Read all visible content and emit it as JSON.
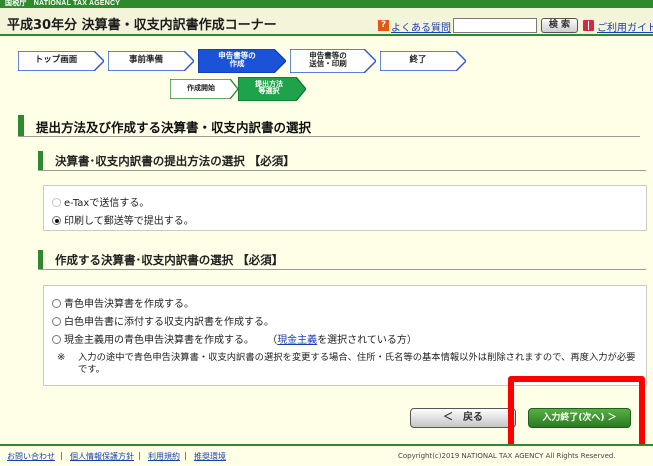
{
  "header": {
    "agency": "国税庁　NATIONAL TAX AGENCY",
    "app_title": "平成30年分 決算書・収支内訳書作成コーナー",
    "faq_label": "よくある質問",
    "search_placeholder": "",
    "search_button": "検 索",
    "guide_label": "ご利用ガイド"
  },
  "steps": [
    {
      "label": "トップ画面",
      "state": "done"
    },
    {
      "label": "事前準備",
      "state": "done"
    },
    {
      "label": "申告書等の\n作成",
      "state": "current"
    },
    {
      "label": "申告書等の\n送信・印刷",
      "state": "todo"
    },
    {
      "label": "終了",
      "state": "todo"
    }
  ],
  "substeps": [
    {
      "label": "作成開始",
      "state": "done"
    },
    {
      "label": "提出方法\n等選択",
      "state": "current"
    }
  ],
  "section": {
    "title": "提出方法及び作成する決算書・収支内訳書の選択"
  },
  "submission": {
    "title": "決算書･収支内訳書の提出方法の選択 【必須】",
    "options": [
      {
        "label": "e-Taxで送信する。",
        "selected": false,
        "disabled": true
      },
      {
        "label": "印刷して郵送等で提出する。",
        "selected": true,
        "disabled": false
      }
    ]
  },
  "creation": {
    "title": "作成する決算書･収支内訳書の選択 【必須】",
    "options": [
      {
        "label": "青色申告決算書を作成する。"
      },
      {
        "label": "白色申告書に添付する収支内訳書を作成する。"
      },
      {
        "label": "現金主義用の青色申告決算書を作成する。",
        "link_prefix": "（",
        "link": "現金主義",
        "link_suffix": "を選択されている方）"
      }
    ],
    "note_mark": "※",
    "note": "入力の途中で青色申告決算書・収支内訳書の選択を変更する場合、住所・氏名等の基本情報以外は削除されますので、再度入力が必要です。"
  },
  "buttons": {
    "back": "＜　戻る",
    "next": "入力終了(次へ) ＞"
  },
  "footer": {
    "links": [
      "お問い合わせ",
      "個人情報保護方針",
      "利用規約",
      "推奨環境"
    ],
    "separator": "|",
    "copyright": "Copyright(c)2019 NATIONAL TAX AGENCY All Rights Reserved."
  },
  "colors": {
    "accent_green": "#2f8a2f",
    "step_current_blue": "#1a52d8",
    "substep_current_green": "#1ea34a",
    "highlight_red": "#ff0000"
  }
}
